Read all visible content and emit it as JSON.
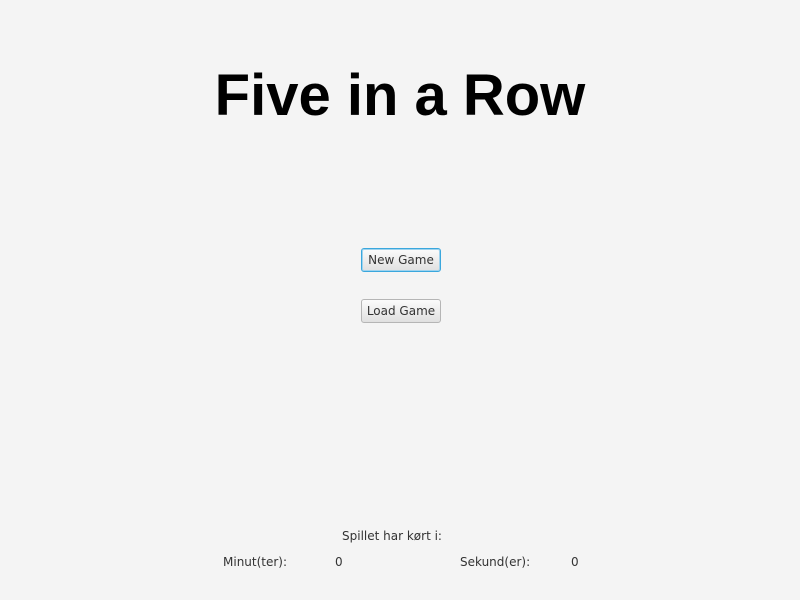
{
  "title": "Five in a Row",
  "buttons": {
    "new_game": "New Game",
    "load_game": "Load Game"
  },
  "timer": {
    "heading": "Spillet har kørt i:",
    "minutes_label": "Minut(ter):",
    "minutes_value": "0",
    "seconds_label": "Sekund(er):",
    "seconds_value": "0"
  },
  "colors": {
    "focus": "#3aa7dd",
    "background": "#f4f4f4"
  }
}
